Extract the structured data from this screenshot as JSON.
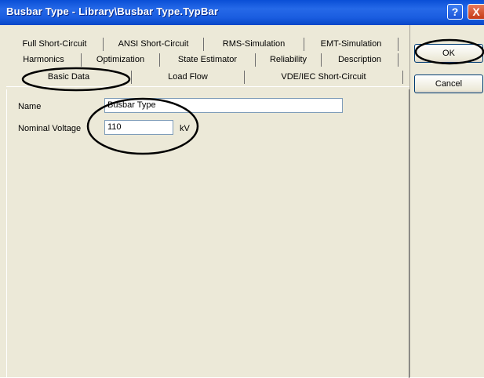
{
  "window": {
    "title": "Busbar Type - Library\\Busbar Type.TypBar",
    "help_glyph": "?",
    "close_glyph": "X",
    "title_color": "#0a4fd6",
    "face_color": "#ece9d8"
  },
  "tabs": {
    "row1": [
      "Full Short-Circuit",
      "ANSI Short-Circuit",
      "RMS-Simulation",
      "EMT-Simulation"
    ],
    "row2": [
      "Harmonics",
      "Optimization",
      "State Estimator",
      "Reliability",
      "Description"
    ],
    "row3": [
      "Basic Data",
      "Load Flow",
      "VDE/IEC Short-Circuit"
    ],
    "selected": "Basic Data"
  },
  "form": {
    "name_label": "Name",
    "name_value": "Busbar Type",
    "voltage_label": "Nominal Voltage",
    "voltage_value": "110",
    "voltage_unit": "kV"
  },
  "buttons": {
    "ok": "OK",
    "cancel": "Cancel"
  }
}
